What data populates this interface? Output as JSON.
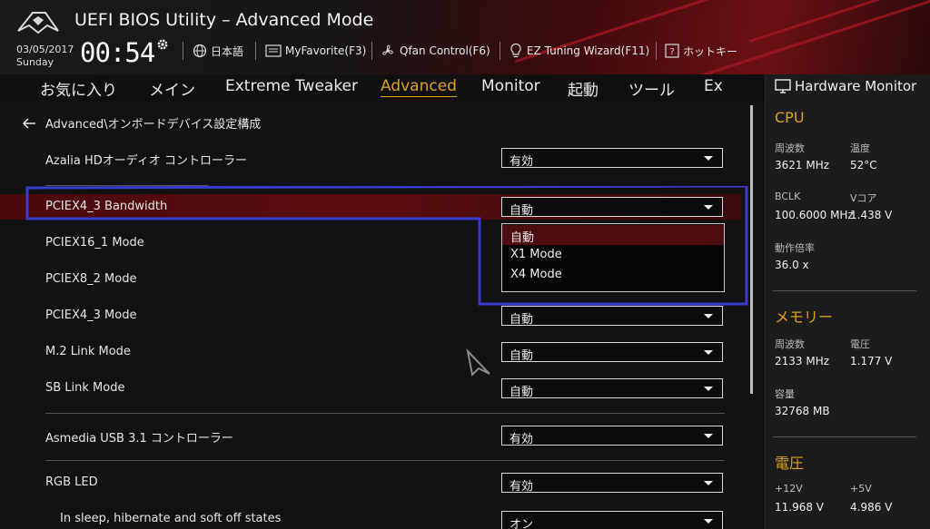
{
  "header": {
    "title": "UEFI BIOS Utility – Advanced Mode",
    "date": "03/05/2017",
    "weekday": "Sunday",
    "time": "00:54",
    "items": {
      "language": "日本語",
      "myfavorite": "MyFavorite(F3)",
      "qfan": "Qfan Control(F6)",
      "ez_tuning": "EZ Tuning Wizard(F11)",
      "hotkeys": "ホットキー"
    }
  },
  "nav": {
    "tabs": [
      "お気に入り",
      "メイン",
      "Extreme Tweaker",
      "Advanced",
      "Monitor",
      "起動",
      "ツール",
      "Ex"
    ],
    "active_index": 3
  },
  "main": {
    "breadcrumb": "Advanced\\オンボードデバイス設定構成",
    "rows": [
      {
        "label": "Azalia HDオーディオ コントローラー",
        "value": "有効"
      },
      {
        "label": "PCIEX4_3 Bandwidth",
        "value": "自動"
      },
      {
        "label": "PCIEX16_1 Mode",
        "value": ""
      },
      {
        "label": "PCIEX8_2 Mode",
        "value": ""
      },
      {
        "label": "PCIEX4_3 Mode",
        "value": "自動"
      },
      {
        "label": "M.2 Link Mode",
        "value": "自動"
      },
      {
        "label": "SB Link Mode",
        "value": "自動"
      },
      {
        "label": "Asmedia USB 3.1 コントローラー",
        "value": "有効"
      },
      {
        "label": "RGB LED",
        "value": "有効"
      },
      {
        "label": "In sleep, hibernate and soft off states",
        "value": "オン"
      }
    ],
    "dropdown_options": [
      "自動",
      "X1 Mode",
      "X4 Mode"
    ],
    "dropdown_selected_index": 0
  },
  "hardware_monitor": {
    "title": "Hardware Monitor",
    "cpu": {
      "heading": "CPU",
      "freq_label": "周波数",
      "freq_value": "3621 MHz",
      "temp_label": "温度",
      "temp_value": "52°C",
      "bclk_label": "BCLK",
      "bclk_value": "100.6000 MHz",
      "vcore_label": "Vコア",
      "vcore_value": "1.438 V",
      "ratio_label": "動作倍率",
      "ratio_value": "36.0 x"
    },
    "memory": {
      "heading": "メモリー",
      "freq_label": "周波数",
      "freq_value": "2133 MHz",
      "volt_label": "電圧",
      "volt_value": "1.177 V",
      "cap_label": "容量",
      "cap_value": "32768 MB"
    },
    "voltage": {
      "heading": "電圧",
      "v12_label": "+12V",
      "v12_value": "11.968 V",
      "v5_label": "+5V",
      "v5_value": "4.986 V"
    }
  },
  "colors": {
    "accent": "#e0a020",
    "highlight_row": "#5a0c10",
    "annotation": "#3a3ad0"
  }
}
